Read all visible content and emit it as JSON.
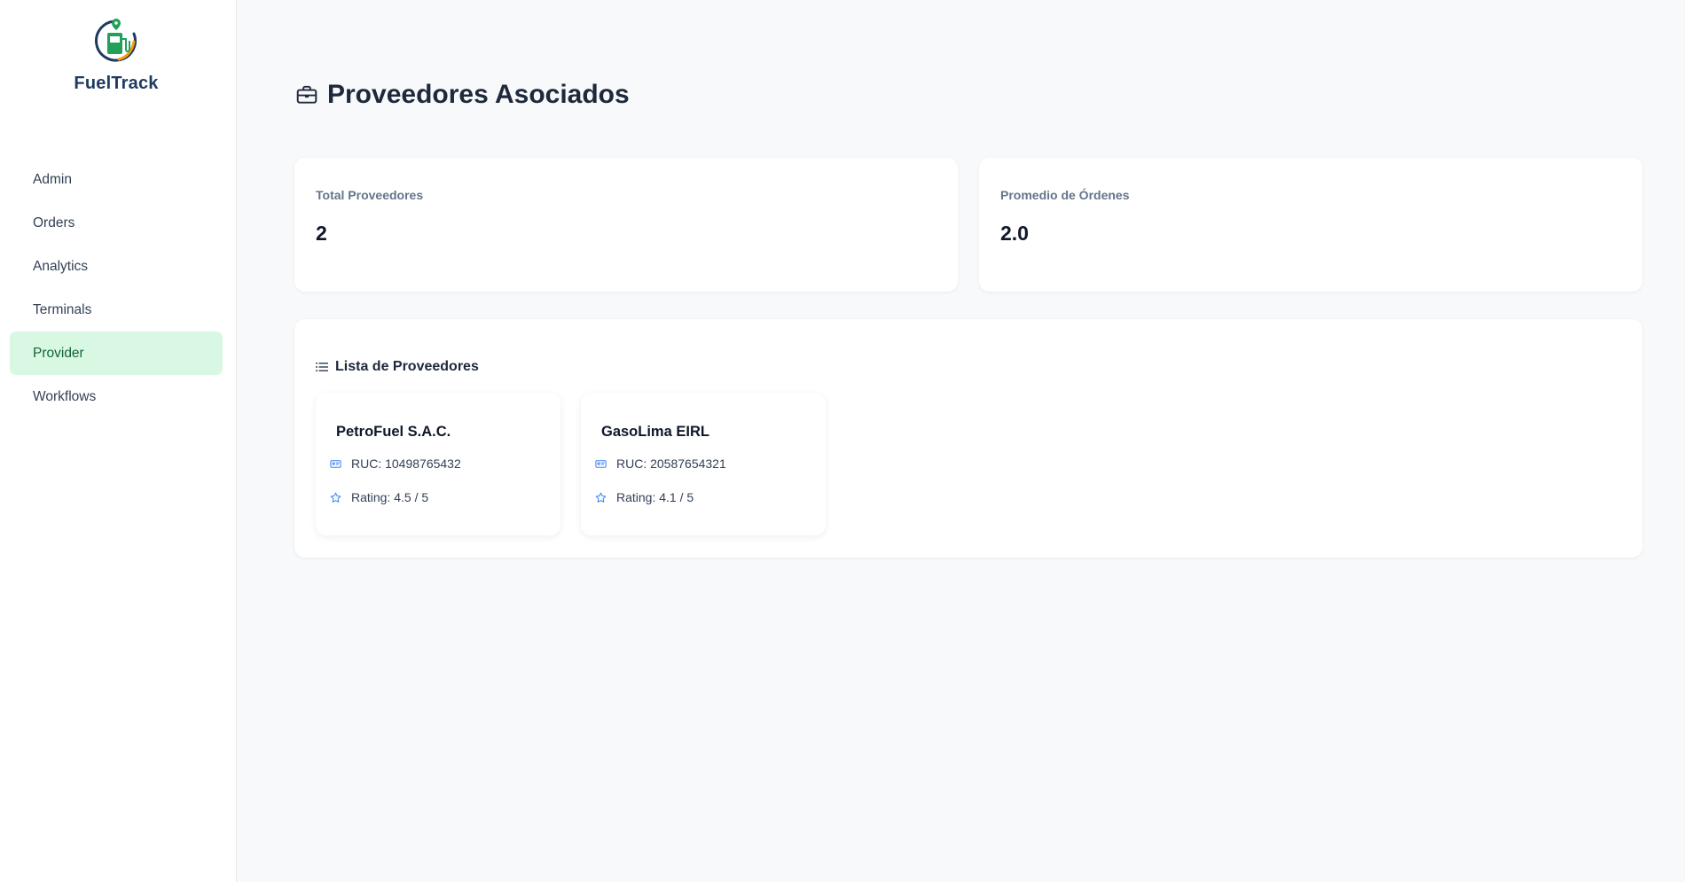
{
  "brand": {
    "name": "FuelTrack",
    "logo_icon": "fuel-pump-location-icon"
  },
  "sidebar": {
    "items": [
      {
        "label": "Admin",
        "active": false
      },
      {
        "label": "Orders",
        "active": false
      },
      {
        "label": "Analytics",
        "active": false
      },
      {
        "label": "Terminals",
        "active": false
      },
      {
        "label": "Provider",
        "active": true
      },
      {
        "label": "Workflows",
        "active": false
      }
    ]
  },
  "page": {
    "title": "Proveedores Asociados",
    "title_icon": "briefcase-icon"
  },
  "stats": [
    {
      "label": "Total Proveedores",
      "value": "2"
    },
    {
      "label": "Promedio de Órdenes",
      "value": "2.0"
    }
  ],
  "list": {
    "title": "Lista de Proveedores",
    "title_icon": "list-icon",
    "providers": [
      {
        "name": "PetroFuel S.A.C.",
        "ruc": "RUC: 10498765432",
        "rating": "Rating: 4.5 / 5"
      },
      {
        "name": "GasoLima EIRL",
        "ruc": "RUC: 20587654321",
        "rating": "Rating: 4.1 / 5"
      }
    ]
  },
  "colors": {
    "accent_green": "#22a05a",
    "active_nav_bg": "#d8f8e3",
    "brand_text": "#1e3a5f",
    "icon_blue": "#3b82f6"
  }
}
